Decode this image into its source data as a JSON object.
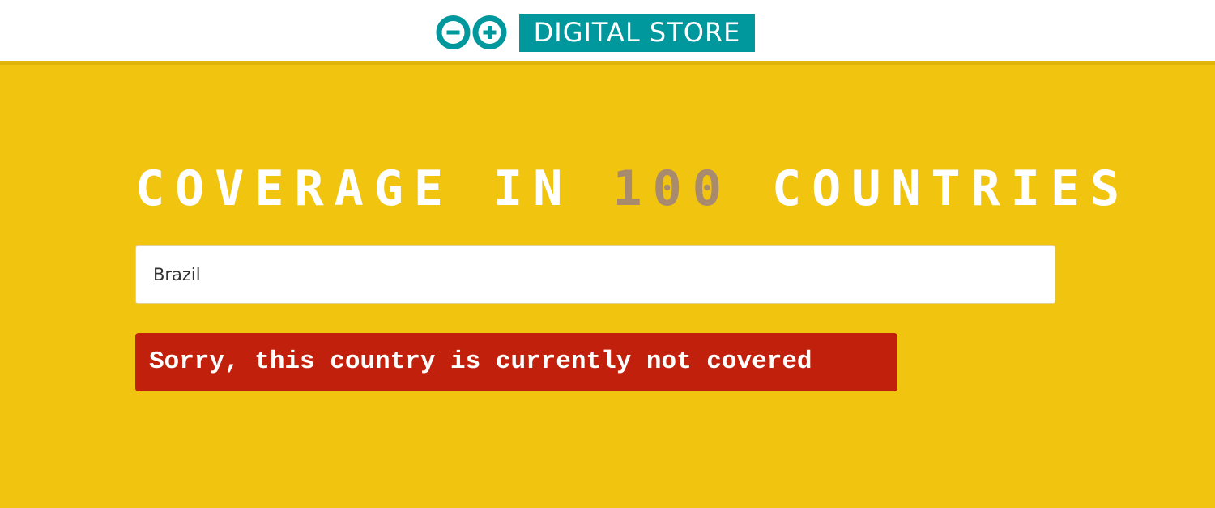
{
  "header": {
    "store_label": "DIGITAL STORE",
    "logo_icon": "arduino-infinity-icon",
    "brand_color": "#00979d"
  },
  "hero": {
    "title_prefix": "COVERAGE IN",
    "title_number": "100",
    "title_suffix": "COUNTRIES"
  },
  "search": {
    "value": "Brazil",
    "placeholder": ""
  },
  "alert": {
    "message": "Sorry, this country is currently not covered",
    "color": "#c1210c"
  },
  "colors": {
    "background": "#f1c40f",
    "title": "#ffffff",
    "accent_number": "#a88a6e"
  }
}
